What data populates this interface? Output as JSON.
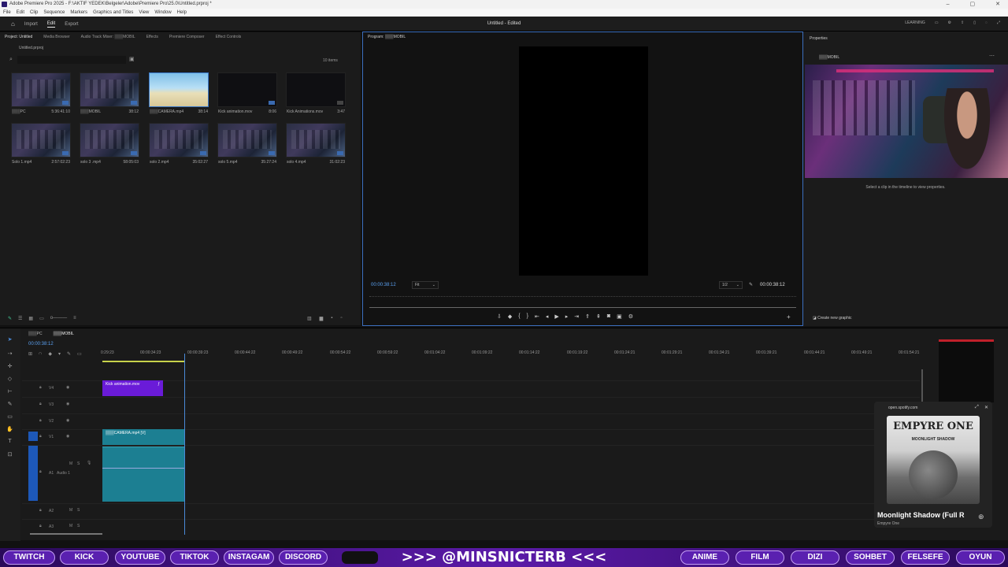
{
  "titlebar": {
    "title": "Adobe Premiere Pro 2025 - F:\\AKTIF YEDEK\\Belgeler\\Adobe\\Premiere Pro\\25.0\\Untitled.prproj *"
  },
  "menu": [
    "File",
    "Edit",
    "Clip",
    "Sequence",
    "Markers",
    "Graphics and Titles",
    "View",
    "Window",
    "Help"
  ],
  "header": {
    "nav": [
      "Import",
      "Edit",
      "Export"
    ],
    "active": "Edit",
    "doc_title": "Untitled - Edited",
    "learning": "LEARNING"
  },
  "project": {
    "tabs": [
      "Project: Untitled",
      "Media Browser",
      "Audio Track Mixer: ▒▒▒MOBIL",
      "Effects",
      "Premiere Composer",
      "Effect Controls"
    ],
    "path": "Untitled.prproj",
    "count": "10 items",
    "items": [
      {
        "name": "▒▒▒PC",
        "dur": "5:36:41:10"
      },
      {
        "name": "▒▒▒MOBIL",
        "dur": "38:12"
      },
      {
        "name": "▒▒▒CAMERA.mp4",
        "dur": "38:14"
      },
      {
        "name": "Kick animation.mov",
        "dur": "8:06"
      },
      {
        "name": "Kick Animations.mov",
        "dur": "3:47"
      },
      {
        "name": "Solo 1.mp4",
        "dur": "2:57:02:23"
      },
      {
        "name": "solo 3 .mp4",
        "dur": "58:05:03"
      },
      {
        "name": "solo 2.mp4",
        "dur": "35:02:27"
      },
      {
        "name": "solo 5.mp4",
        "dur": "35:27:24"
      },
      {
        "name": "solo 4.mp4",
        "dur": "31:02:23"
      }
    ]
  },
  "monitor": {
    "tab": "Program: ▒▒▒MOBIL",
    "timecode_left": "00:00:38:12",
    "fit": "Fit",
    "quality": "1/2",
    "timecode_right": "00:00:38:12"
  },
  "properties": {
    "title": "Properties",
    "sequence": "▒▒▒MOBIL",
    "hint": "Select a clip in the timeline to view properties.",
    "create_graphic": "Create new graphic"
  },
  "timeline": {
    "tabs": [
      "▒▒▒PC",
      "▒▒▒MOBIL"
    ],
    "timecode": "00:00:38:12",
    "ruler": [
      "0:29:23",
      "00:00:34:23",
      "00:00:39:23",
      "00:00:44:22",
      "00:00:49:22",
      "00:00:54:22",
      "00:00:59:22",
      "00:01:04:22",
      "00:01:09:22",
      "00:01:14:22",
      "00:01:19:22",
      "00:01:24:21",
      "00:01:29:21",
      "00:01:34:21",
      "00:01:39:21",
      "00:01:44:21",
      "00:01:49:21",
      "00:01:54:21"
    ],
    "tracks": [
      "V4",
      "V3",
      "V2",
      "V1",
      "A1",
      "A2",
      "A3"
    ],
    "audio_label": "Audio 1",
    "clips": {
      "kick": "Kick animation.mov",
      "camera": "▒▒▒CAMERA.mp4 [V]"
    }
  },
  "spotify": {
    "url": "open.spotify.com",
    "album_title": "EMPYRE ONE",
    "album_sub": "MOONLIGHT SHADOW",
    "song": "Moonlight Shadow (Full R",
    "artist": "Empyre One"
  },
  "bar": {
    "left": [
      "TWITCH",
      "KICK",
      "YOUTUBE",
      "TIKTOK",
      "INSTAGAM",
      "DISCORD"
    ],
    "center": ">>> @MINSNICTERB <<<",
    "right": [
      "ANIME",
      "FILM",
      "DIZI",
      "SOHBET",
      "FELSEFE",
      "OYUN"
    ]
  },
  "colors": {
    "accent": "#3c6fbf",
    "kick_clip": "#6a1bd8",
    "camera_clip": "#1c7f92",
    "bar": "#5a20b0"
  }
}
